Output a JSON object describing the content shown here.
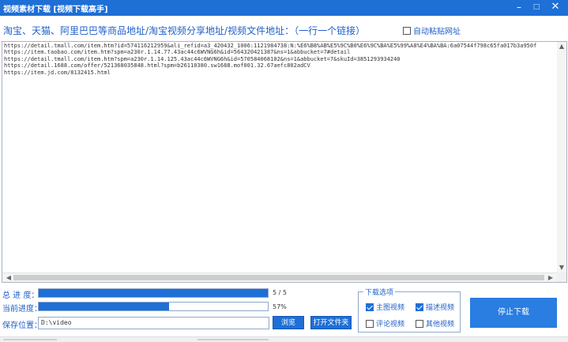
{
  "window": {
    "title": "视频素材下载 [视频下载高手]",
    "min_glyph": "–",
    "max_glyph": "□",
    "close_glyph": "✕"
  },
  "header": {
    "instruction": "淘宝、天猫、阿里巴巴等商品地址/淘宝视频分享地址/视频文件地址：（一行一个链接）",
    "auto_paste_label": "自动粘贴网址",
    "auto_paste_checked": false
  },
  "url_list": {
    "lines": [
      "https://detail.tmall.com/item.htm?id=574116212959&ali_refid=a3_420432_1006:1121984738:N:%E6%B8%AB%E5%9C%B0%E6%9C%BA%E5%99%A8%E4%BA%BA:6a07544f798c65fa017b3a950f",
      "https://item.taobao.com/item.htm?spm=a230r.1.14.77.43ac44c6WVNG6h&id=564320421387&ns=1&abbucket=7#detail",
      "https://detail.tmall.com/item.htm?spm=a230r.1.14.125.43ac44c6WVNG6h&id=570584068102&ns=1&abbucket=7&skuId=3851293934240",
      "https://detail.1688.com/offer/521368035848.html?spm=b26110380.sw1688.mof001.32.67aefc802adCV",
      "https://item.jd.com/8132415.html"
    ]
  },
  "progress": {
    "total_label": "总 进 度：",
    "total_fraction": 1.0,
    "total_text": "5 / 5",
    "current_label": "当前进度：",
    "current_fraction": 0.57,
    "current_text": "57%"
  },
  "save": {
    "label": "保存位置：",
    "path": "D:\\video",
    "browse_label": "浏览",
    "open_folder_label": "打开文件夹"
  },
  "options": {
    "legend": "下载选项",
    "items": [
      {
        "label": "主图视频",
        "checked": true
      },
      {
        "label": "描述视频",
        "checked": true
      },
      {
        "label": "评论视频",
        "checked": false
      },
      {
        "label": "其他视频",
        "checked": false
      }
    ]
  },
  "actions": {
    "stop_download_label": "停止下载"
  }
}
